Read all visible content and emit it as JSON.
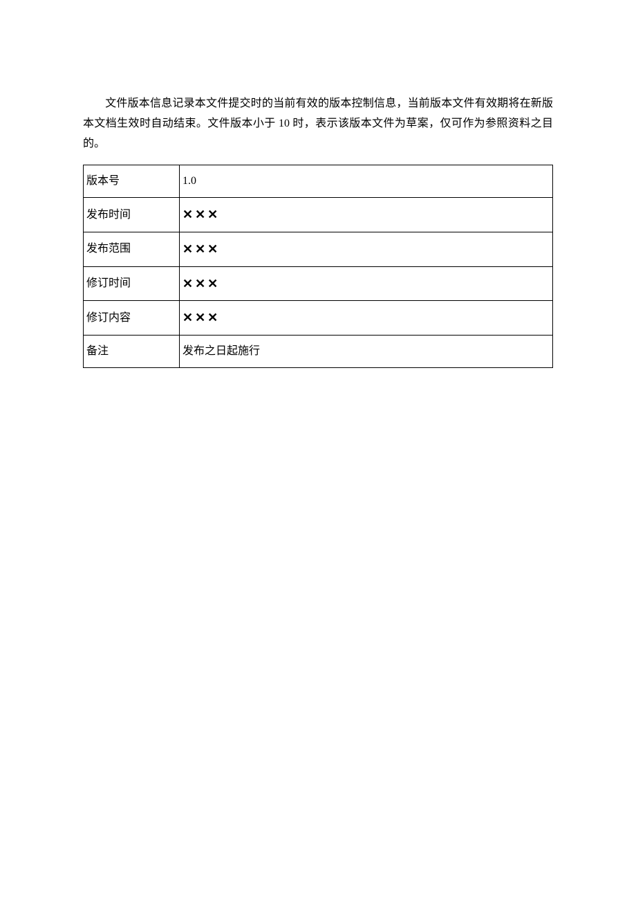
{
  "paragraph": "文件版本信息记录本文件提交时的当前有效的版本控制信息，当前版本文件有效期将在新版本文档生效时自动结束。文件版本小于 10 时，表示该版本文件为草案，仅可作为参照资料之目的。",
  "table": {
    "rows": [
      {
        "label": "版本号",
        "value": "1.0",
        "xxx": false
      },
      {
        "label": "发布时间",
        "value": "✕✕✕",
        "xxx": true
      },
      {
        "label": "发布范围",
        "value": "✕✕✕",
        "xxx": true
      },
      {
        "label": "修订时间",
        "value": "✕✕✕",
        "xxx": true
      },
      {
        "label": "修订内容",
        "value": "✕✕✕",
        "xxx": true
      },
      {
        "label": "备注",
        "value": "发布之日起施行",
        "xxx": false
      }
    ]
  }
}
